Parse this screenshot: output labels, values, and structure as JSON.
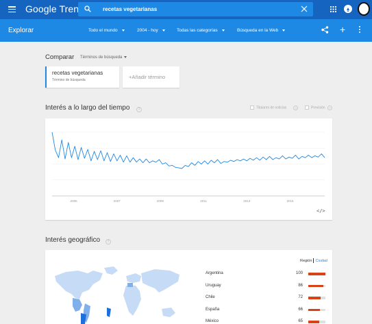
{
  "header": {
    "logo": "Google Trends",
    "search_value": "recetas vegetarianas",
    "icons": [
      "menu-icon",
      "search-icon",
      "clear-icon",
      "apps-icon",
      "notifications-icon",
      "avatar"
    ]
  },
  "explore_bar": {
    "title": "Explorar",
    "filters": [
      {
        "label": "Todo el mundo"
      },
      {
        "label": "2004 - hoy"
      },
      {
        "label": "Todas las categorías"
      },
      {
        "label": "Búsqueda en la Web"
      }
    ],
    "icons": [
      "share-icon",
      "plus-icon",
      "more-vert-icon"
    ]
  },
  "compare": {
    "title": "Comparar",
    "type_label": "Términos de búsqueda",
    "term": {
      "name": "recetas vegetarianas",
      "subtitle": "Término de búsqueda"
    },
    "add_label": "+Añadir término"
  },
  "interest_over_time": {
    "title": "Interés a lo largo del tiempo",
    "help": "?",
    "options": [
      "Titulares de noticias",
      "Previsión"
    ],
    "embed_label": "</>",
    "accent": "#1e88e5",
    "chart_data": {
      "type": "line",
      "x_ticks": [
        "2005",
        "2007",
        "2009",
        "2011",
        "2013",
        "2015"
      ],
      "xlim": [
        2004,
        2016.6
      ],
      "ylim": [
        0,
        100
      ],
      "grid": true,
      "series": [
        {
          "x": [
            2004.0,
            2004.15,
            2004.3,
            2004.45,
            2004.6,
            2004.75,
            2004.9,
            2005.05,
            2005.2,
            2005.35,
            2005.5,
            2005.65,
            2005.8,
            2005.95,
            2006.1,
            2006.25,
            2006.4,
            2006.55,
            2006.7,
            2006.85,
            2007.0,
            2007.15,
            2007.3,
            2007.45,
            2007.6,
            2007.75,
            2007.9,
            2008.05,
            2008.2,
            2008.35,
            2008.5,
            2008.65,
            2008.8,
            2008.95,
            2009.1,
            2009.25,
            2009.4,
            2009.55,
            2009.7,
            2009.85,
            2010.0,
            2010.15,
            2010.3,
            2010.45,
            2010.6,
            2010.75,
            2010.9,
            2011.05,
            2011.2,
            2011.35,
            2011.5,
            2011.65,
            2011.8,
            2011.95,
            2012.1,
            2012.25,
            2012.4,
            2012.55,
            2012.7,
            2012.85,
            2013.0,
            2013.15,
            2013.3,
            2013.45,
            2013.6,
            2013.75,
            2013.9,
            2014.05,
            2014.2,
            2014.35,
            2014.5,
            2014.65,
            2014.8,
            2014.95,
            2015.1,
            2015.25,
            2015.4,
            2015.55,
            2015.7,
            2015.85,
            2016.0,
            2016.15,
            2016.3,
            2016.45,
            2016.6
          ],
          "values": [
            100,
            72,
            60,
            88,
            58,
            84,
            60,
            78,
            57,
            76,
            59,
            73,
            55,
            70,
            57,
            71,
            55,
            68,
            54,
            66,
            55,
            64,
            53,
            63,
            53,
            60,
            53,
            58,
            52,
            58,
            52,
            55,
            53,
            57,
            50,
            52,
            47,
            48,
            45,
            44,
            43,
            48,
            46,
            52,
            48,
            54,
            50,
            55,
            50,
            56,
            52,
            57,
            51,
            54,
            53,
            56,
            54,
            57,
            55,
            58,
            55,
            59,
            56,
            60,
            56,
            61,
            57,
            62,
            57,
            60,
            58,
            63,
            58,
            61,
            59,
            64,
            58,
            62,
            60,
            64,
            60,
            63,
            61,
            66,
            60
          ]
        }
      ]
    }
  },
  "geo": {
    "title": "Interés geográfico",
    "help": "?",
    "toggle": {
      "region": "Región",
      "city": "Ciudad"
    },
    "bar_color": "#d84315",
    "rows": [
      {
        "name": "Argentina",
        "value": "100",
        "fraction": 1.0
      },
      {
        "name": "Uruguay",
        "value": "86",
        "fraction": 0.86
      },
      {
        "name": "Chile",
        "value": "72",
        "fraction": 0.72
      },
      {
        "name": "España",
        "value": "66",
        "fraction": 0.66
      },
      {
        "name": "México",
        "value": "65",
        "fraction": 0.65
      }
    ]
  }
}
